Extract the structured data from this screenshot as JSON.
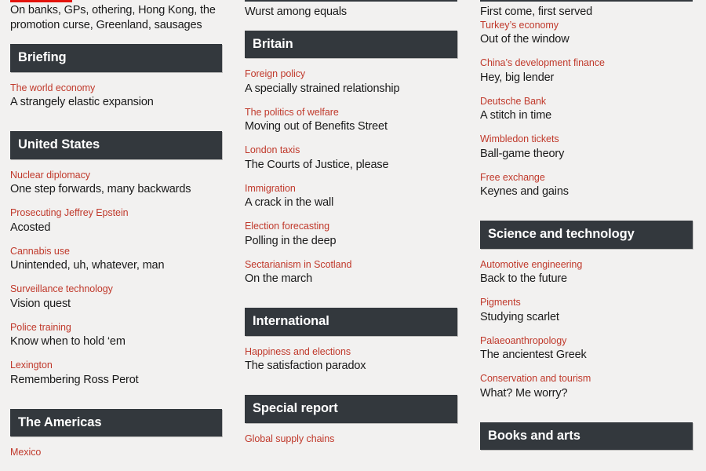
{
  "page": {
    "background_color": "#f2f1f0",
    "accent_red": "#c0392b",
    "brand_red": "#e3120b",
    "header_bar_color": "#33383d",
    "headline_color": "#1a1a1a"
  },
  "columns": [
    {
      "id": "column-1",
      "lead_continuation": "On banks, GPs, othering, Hong Kong, the promotion curse, Greenland, sausages",
      "sections": [
        {
          "title": "Briefing",
          "articles": [
            {
              "kicker": "The world economy",
              "headline": "A strangely elastic expansion"
            }
          ]
        },
        {
          "title": "United States",
          "articles": [
            {
              "kicker": "Nuclear diplomacy",
              "headline": "One step forwards, many backwards"
            },
            {
              "kicker": "Prosecuting Jeffrey Epstein",
              "headline": "Acosted"
            },
            {
              "kicker": "Cannabis use",
              "headline": "Unintended, uh, whatever, man"
            },
            {
              "kicker": "Surveillance technology",
              "headline": "Vision quest"
            },
            {
              "kicker": "Police training",
              "headline": "Know when to hold ‘em"
            },
            {
              "kicker": "Lexington",
              "headline": "Remembering Ross Perot"
            }
          ]
        },
        {
          "title": "The Americas",
          "articles": [
            {
              "kicker": "Mexico",
              "headline": ""
            }
          ]
        }
      ]
    },
    {
      "id": "column-2",
      "lead_continuation": "Wurst among equals",
      "sections": [
        {
          "title": "Britain",
          "articles": [
            {
              "kicker": "Foreign policy",
              "headline": "A specially strained relationship"
            },
            {
              "kicker": "The politics of welfare",
              "headline": "Moving out of Benefits Street"
            },
            {
              "kicker": "London taxis",
              "headline": "The Courts of Justice, please"
            },
            {
              "kicker": "Immigration",
              "headline": "A crack in the wall"
            },
            {
              "kicker": "Election forecasting",
              "headline": "Polling in the deep"
            },
            {
              "kicker": "Sectarianism in Scotland",
              "headline": "On the march"
            }
          ]
        },
        {
          "title": "International",
          "articles": [
            {
              "kicker": "Happiness and elections",
              "headline": "The satisfaction paradox"
            }
          ]
        },
        {
          "title": "Special report",
          "articles": [
            {
              "kicker": "Global supply chains",
              "headline": ""
            }
          ]
        }
      ]
    },
    {
      "id": "column-3",
      "lead_continuation": "First come, first served",
      "sections": [
        {
          "title": "",
          "articles": [
            {
              "kicker": "Turkey’s economy",
              "headline": "Out of the window"
            },
            {
              "kicker": "China’s development finance",
              "headline": "Hey, big lender"
            },
            {
              "kicker": "Deutsche Bank",
              "headline": "A stitch in time"
            },
            {
              "kicker": "Wimbledon tickets",
              "headline": "Ball-game theory"
            },
            {
              "kicker": "Free exchange",
              "headline": "Keynes and gains"
            }
          ]
        },
        {
          "title": "Science and technology",
          "articles": [
            {
              "kicker": "Automotive engineering",
              "headline": "Back to the future"
            },
            {
              "kicker": "Pigments",
              "headline": "Studying scarlet"
            },
            {
              "kicker": "Palaeoanthropology",
              "headline": "The ancientest Greek"
            },
            {
              "kicker": "Conservation and tourism",
              "headline": "What? Me worry?"
            }
          ]
        },
        {
          "title": "Books and arts",
          "articles": []
        }
      ]
    }
  ]
}
